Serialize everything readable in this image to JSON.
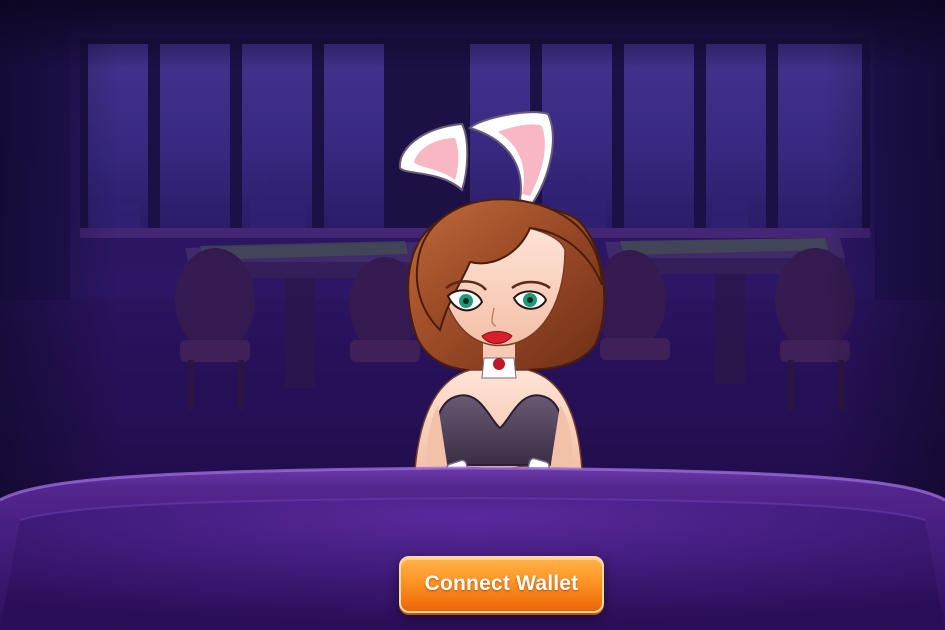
{
  "game": {
    "connect_wallet_label": "Connect Wallet"
  },
  "colors": {
    "button_orange": "#f47a12",
    "button_highlight": "#ffb24a",
    "room_purple": "#3a1f7a",
    "table_felt": "#3b1670"
  },
  "icons": {
    "dealer": "bunny-dealer-character",
    "room": "casino-lounge-background"
  }
}
